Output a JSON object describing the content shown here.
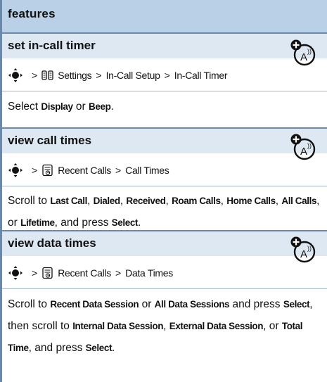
{
  "header": {
    "title": "features"
  },
  "sections": [
    {
      "title": "set in-call timer",
      "path": {
        "sep": ">",
        "items": [
          "Settings",
          "In-Call Setup",
          "In-Call Timer"
        ]
      },
      "body": [
        {
          "t": "Select ",
          "b": false
        },
        {
          "t": "Display",
          "b": true
        },
        {
          "t": " or ",
          "b": false
        },
        {
          "t": "Beep",
          "b": true
        },
        {
          "t": ".",
          "b": false
        }
      ]
    },
    {
      "title": "view call times",
      "path": {
        "sep": ">",
        "items": [
          "Recent Calls",
          "Call Times"
        ]
      },
      "body": [
        {
          "t": "Scroll to ",
          "b": false
        },
        {
          "t": "Last Call",
          "b": true
        },
        {
          "t": ", ",
          "b": false
        },
        {
          "t": "Dialed",
          "b": true
        },
        {
          "t": ", ",
          "b": false
        },
        {
          "t": "Received",
          "b": true
        },
        {
          "t": ", ",
          "b": false
        },
        {
          "t": "Roam Calls",
          "b": true
        },
        {
          "t": ", ",
          "b": false
        },
        {
          "t": "Home Calls",
          "b": true
        },
        {
          "t": ", ",
          "b": false
        },
        {
          "t": "All Calls",
          "b": true
        },
        {
          "t": ", or ",
          "b": false
        },
        {
          "t": "Lifetime",
          "b": true
        },
        {
          "t": ", and press ",
          "b": false
        },
        {
          "t": "Select",
          "b": true
        },
        {
          "t": ".",
          "b": false
        }
      ]
    },
    {
      "title": "view data times",
      "path": {
        "sep": ">",
        "items": [
          "Recent Calls",
          "Data Times"
        ]
      },
      "body": [
        {
          "t": "Scroll to ",
          "b": false
        },
        {
          "t": "Recent Data Session",
          "b": true
        },
        {
          "t": " or ",
          "b": false
        },
        {
          "t": "All Data Sessions",
          "b": true
        },
        {
          "t": " and press ",
          "b": false
        },
        {
          "t": "Select",
          "b": true
        },
        {
          "t": ", then scroll to ",
          "b": false
        },
        {
          "t": "Internal Data Session",
          "b": true
        },
        {
          "t": ", ",
          "b": false
        },
        {
          "t": "External Data Session",
          "b": true
        },
        {
          "t": ", or ",
          "b": false
        },
        {
          "t": "Total Time",
          "b": true
        },
        {
          "t": ", and press ",
          "b": false
        },
        {
          "t": "Select",
          "b": true
        },
        {
          "t": ".",
          "b": false
        }
      ]
    }
  ],
  "icons": {
    "nav_key": "nav-key-icon",
    "settings": "settings-icon",
    "recent_calls": "recent-calls-icon",
    "network_feature": "network-feature-icon"
  },
  "colors": {
    "header_bg": "#b9d0e6",
    "section_bg": "#dde8f3",
    "rule": "#6b88a8"
  }
}
